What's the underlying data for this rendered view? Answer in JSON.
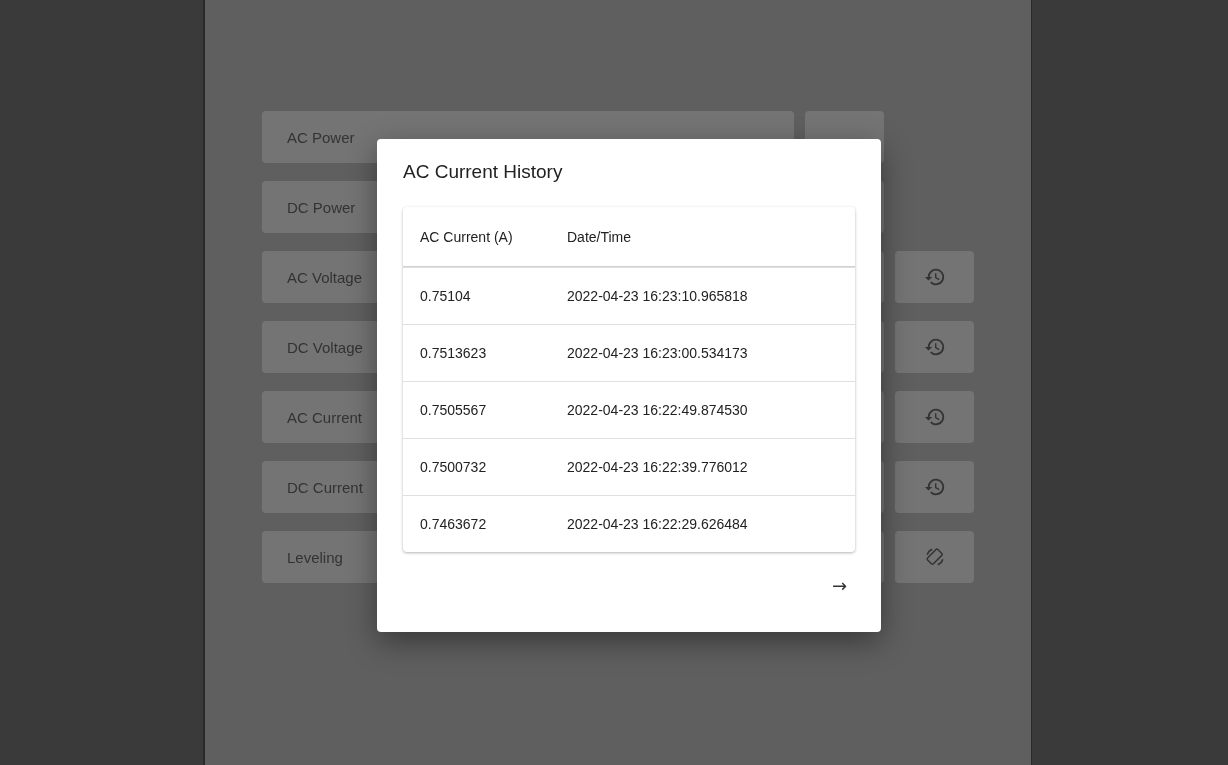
{
  "metrics": [
    {
      "label": "AC Power",
      "kind": "single"
    },
    {
      "label": "DC Power",
      "kind": "single"
    },
    {
      "label": "AC Voltage",
      "kind": "history"
    },
    {
      "label": "DC Voltage",
      "kind": "history"
    },
    {
      "label": "AC Current",
      "kind": "history"
    },
    {
      "label": "DC Current",
      "kind": "history"
    },
    {
      "label": "Leveling",
      "kind": "leveling"
    }
  ],
  "dialog": {
    "title": "AC Current History",
    "table": {
      "columns": [
        "AC Current (A)",
        "Date/Time"
      ],
      "rows": [
        [
          "0.75104",
          "2022-04-23 16:23:10.965818"
        ],
        [
          "0.7513623",
          "2022-04-23 16:23:00.534173"
        ],
        [
          "0.7505567",
          "2022-04-23 16:22:49.874530"
        ],
        [
          "0.7500732",
          "2022-04-23 16:22:39.776012"
        ],
        [
          "0.7463672",
          "2022-04-23 16:22:29.626484"
        ]
      ]
    },
    "next": "→"
  }
}
